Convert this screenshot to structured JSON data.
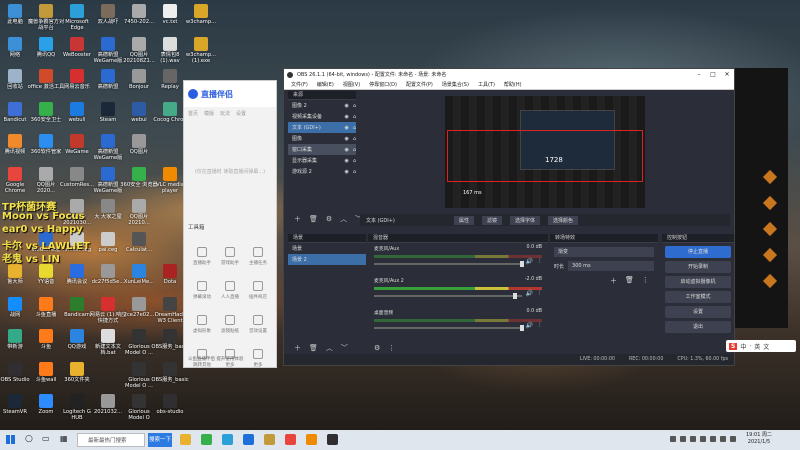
{
  "desktop": {
    "icons": [
      {
        "label": "此电脑",
        "col": 0,
        "row": 0,
        "color": "#3d8fd6"
      },
      {
        "label": "魔兽争霸官方对战平台",
        "col": 1,
        "row": 0,
        "color": "#c29a3a"
      },
      {
        "label": "Microsoft Edge",
        "col": 2,
        "row": 0,
        "color": "#2a9fd8"
      },
      {
        "label": "双人战吓",
        "col": 3,
        "row": 0,
        "color": "#7a6b5a"
      },
      {
        "label": "7450-202...",
        "col": 4,
        "row": 0,
        "color": "#aaa"
      },
      {
        "label": "vc.txt",
        "col": 5,
        "row": 0,
        "color": "#eee"
      },
      {
        "label": "w3champ...",
        "col": 6,
        "row": 0,
        "color": "#d8a72a"
      },
      {
        "label": "网络",
        "col": 0,
        "row": 1,
        "color": "#3d8fd6"
      },
      {
        "label": "腾讯QQ",
        "col": 1,
        "row": 1,
        "color": "#2aa0e8"
      },
      {
        "label": "WeBooster",
        "col": 2,
        "row": 1,
        "color": "#c73535"
      },
      {
        "label": "高德新盟 WeGame版",
        "col": 3,
        "row": 1,
        "color": "#2b6ad0"
      },
      {
        "label": "QQ图片 202108Z1...",
        "col": 4,
        "row": 1,
        "color": "#aaa"
      },
      {
        "label": "表情包8 (1).wav",
        "col": 5,
        "row": 1,
        "color": "#ddd"
      },
      {
        "label": "w3champ... (1).exe",
        "col": 6,
        "row": 1,
        "color": "#d8a72a"
      },
      {
        "label": "回收站",
        "col": 0,
        "row": 2,
        "color": "#9cb3c9"
      },
      {
        "label": "office 激活工具",
        "col": 1,
        "row": 2,
        "color": "#d14b2b"
      },
      {
        "label": "网易云音乐",
        "col": 2,
        "row": 2,
        "color": "#d62f2f"
      },
      {
        "label": "高德新盟",
        "col": 3,
        "row": 2,
        "color": "#2b6ad0"
      },
      {
        "label": "Bonjour",
        "col": 4,
        "row": 2,
        "color": "#999"
      },
      {
        "label": "Replay",
        "col": 5,
        "row": 2,
        "color": "#666"
      },
      {
        "label": "Bandicut",
        "col": 0,
        "row": 3,
        "color": "#3d6fd6"
      },
      {
        "label": "360安全卫士",
        "col": 1,
        "row": 3,
        "color": "#35b04a"
      },
      {
        "label": "webull",
        "col": 2,
        "row": 3,
        "color": "#1c7be0"
      },
      {
        "label": "Steam",
        "col": 3,
        "row": 3,
        "color": "#1b2838"
      },
      {
        "label": "webui",
        "col": 4,
        "row": 3,
        "color": "#2d5ba5"
      },
      {
        "label": "Cocog Chron",
        "col": 5,
        "row": 3,
        "color": "#4a8"
      },
      {
        "label": "腾讯视频",
        "col": 0,
        "row": 4,
        "color": "#f08a2c"
      },
      {
        "label": "360软件管家",
        "col": 1,
        "row": 4,
        "color": "#2c8ef0"
      },
      {
        "label": "WeGame",
        "col": 2,
        "row": 4,
        "color": "#c0392b"
      },
      {
        "label": "高德新盟 WeGame版",
        "col": 3,
        "row": 4,
        "color": "#2b6ad0"
      },
      {
        "label": "QQ图片",
        "col": 4,
        "row": 4,
        "color": "#999"
      },
      {
        "label": "Google Chrome",
        "col": 0,
        "row": 5,
        "color": "#e8453c"
      },
      {
        "label": "QQ图片 2020...",
        "col": 1,
        "row": 5,
        "color": "#aaa"
      },
      {
        "label": "CustomRes...",
        "col": 2,
        "row": 5,
        "color": "#888"
      },
      {
        "label": "高德新盟 WeGame版",
        "col": 3,
        "row": 5,
        "color": "#2b6ad0"
      },
      {
        "label": "360安全 浏览器",
        "col": 4,
        "row": 5,
        "color": "#35b04a"
      },
      {
        "label": "VLC media player",
        "col": 5,
        "row": 5,
        "color": "#f08a00"
      },
      {
        "label": "QQ图片 2021030...",
        "col": 2,
        "row": 6,
        "color": "#aaa"
      },
      {
        "label": "大 大家之屋",
        "col": 3,
        "row": 6,
        "color": "#888"
      },
      {
        "label": "QQ图片 20210...",
        "col": 4,
        "row": 6,
        "color": "#aaa"
      },
      {
        "label": "WeGame版",
        "col": 1,
        "row": 7,
        "color": "#2b6ad0"
      },
      {
        "label": "xmilelf.ceg",
        "col": 2,
        "row": 7,
        "color": "#ccc"
      },
      {
        "label": "pai.ceg",
        "col": 3,
        "row": 7,
        "color": "#ccc"
      },
      {
        "label": "Calculat...",
        "col": 4,
        "row": 7,
        "color": "#555"
      },
      {
        "label": "鲁大师",
        "col": 0,
        "row": 8,
        "color": "#e8b12e"
      },
      {
        "label": "YY语音",
        "col": 1,
        "row": 8,
        "color": "#e8d92e"
      },
      {
        "label": "腾讯会议",
        "col": 2,
        "row": 8,
        "color": "#2a6de0"
      },
      {
        "label": "dc27f5d5e...",
        "col": 3,
        "row": 8,
        "color": "#999"
      },
      {
        "label": "XunLeiMe...",
        "col": 4,
        "row": 8,
        "color": "#2a84e0"
      },
      {
        "label": "Dota",
        "col": 5,
        "row": 8,
        "color": "#a22"
      },
      {
        "label": "战网",
        "col": 0,
        "row": 9,
        "color": "#148eff"
      },
      {
        "label": "斗鱼直播",
        "col": 1,
        "row": 9,
        "color": "#ff7b1a"
      },
      {
        "label": "Bandicam",
        "col": 2,
        "row": 9,
        "color": "#2c7d2c"
      },
      {
        "label": "网易云 (1):响应 快捷方式",
        "col": 3,
        "row": 9,
        "color": "#d62f2f"
      },
      {
        "label": "2ce27e02...",
        "col": 4,
        "row": 9,
        "color": "#999"
      },
      {
        "label": "DreamHack W3 Client",
        "col": 5,
        "row": 9,
        "color": "#444"
      },
      {
        "label": "RUSH ULT",
        "col": 6,
        "row": 9,
        "color": "#a33"
      },
      {
        "label": "带新游",
        "col": 0,
        "row": 10,
        "color": "#3a8"
      },
      {
        "label": "斗鱼",
        "col": 1,
        "row": 10,
        "color": "#ff7b1a"
      },
      {
        "label": "QQ游戏",
        "col": 2,
        "row": 10,
        "color": "#2a84e0"
      },
      {
        "label": "新建文本文档.bat",
        "col": 3,
        "row": 10,
        "color": "#ddd"
      },
      {
        "label": "Glorious Model O ...",
        "col": 4,
        "row": 10,
        "color": "#333"
      },
      {
        "label": "OBS服务_basic",
        "col": 5,
        "row": 10,
        "color": "#333"
      },
      {
        "label": "OBS Studio",
        "col": 0,
        "row": 11,
        "color": "#302e31"
      },
      {
        "label": "斗鱼wall",
        "col": 1,
        "row": 11,
        "color": "#ff7b1a"
      },
      {
        "label": "360文件夹",
        "col": 2,
        "row": 11,
        "color": "#e8b12e"
      },
      {
        "label": "Glorious Model O ...",
        "col": 4,
        "row": 11,
        "color": "#333"
      },
      {
        "label": "OBS服务_basic",
        "col": 5,
        "row": 11,
        "color": "#333"
      },
      {
        "label": "SteamVR",
        "col": 0,
        "row": 12,
        "color": "#1b2838"
      },
      {
        "label": "Zoom",
        "col": 1,
        "row": 12,
        "color": "#2d8cff"
      },
      {
        "label": "Logitech G HUB",
        "col": 2,
        "row": 12,
        "color": "#222"
      },
      {
        "label": "2021032...",
        "col": 3,
        "row": 12,
        "color": "#999"
      },
      {
        "label": "Glorious Model O",
        "col": 4,
        "row": 12,
        "color": "#333"
      },
      {
        "label": "obs-studio",
        "col": 5,
        "row": 12,
        "color": "#302e31"
      }
    ],
    "overlay_lines": [
      "TP杯菌环赛",
      "Moon vs Focus",
      "ear0 vs Happy",
      "卡尔 vs LAWLIET",
      "老鬼 vs LIN"
    ]
  },
  "helper": {
    "brand": "直播伴侣",
    "tabs": [
      "首页",
      "模版",
      "玩法",
      "设置"
    ],
    "placeholder": "(仅在直播时 读取直播间弹幕...)",
    "tools_label": "工具箱",
    "tools": [
      "直播助手",
      "游戏助手",
      "主播任务",
      "弹幕滚动",
      "人人直播",
      "插件商店",
      "虚拟形象",
      "滤镜贴纸",
      "音效设置",
      "跳转其他",
      "更多",
      "更多"
    ],
    "footer": "斗鱼直播伴侣 提升使用体验"
  },
  "obs": {
    "title": "OBS 26.1.1 (64-bit, windows) - 配置文件: 未命名 - 场景: 未命名",
    "menu": [
      "文件(F)",
      "编辑(E)",
      "视图(V)",
      "停靠窗口(D)",
      "配置文件(P)",
      "场景集合(S)",
      "工具(T)",
      "帮助(H)"
    ],
    "sources_title": "来源",
    "sources": [
      {
        "name": "图像 2",
        "state": "normal"
      },
      {
        "name": "视频采集设备",
        "state": "normal"
      },
      {
        "name": "文本 (GDI+)",
        "state": "selected"
      },
      {
        "name": "图像",
        "state": "normal"
      },
      {
        "name": "窗口采集",
        "state": "hover"
      },
      {
        "name": "显示器采集",
        "state": "normal"
      },
      {
        "name": "游戏源 2",
        "state": "normal"
      }
    ],
    "source_toolbar": {
      "current": "文本 (GDI+)",
      "props": "属性",
      "filters": "滤镜",
      "select_font": "选择字体",
      "select_color": "选择颜色"
    },
    "scenes_title": "场景",
    "scenes": [
      "场景",
      "场景 2"
    ],
    "mixer_title": "混音器",
    "mixer": [
      {
        "name": "麦克风/Aux",
        "db": "0.0 dB",
        "active": false,
        "fader": 0.99
      },
      {
        "name": "麦克风/Aux 2",
        "db": "-2.0 dB",
        "active": true,
        "fader": 0.94
      },
      {
        "name": "桌面音频",
        "db": "0.0 dB",
        "active": false,
        "fader": 0.99
      }
    ],
    "transitions_title": "转场特效",
    "transition": "渐变",
    "duration_label": "时长",
    "duration_value": "300 ms",
    "controls_title": "控制按钮",
    "controls": [
      "停止直播",
      "开始录制",
      "启动虚拟摄像机",
      "工作室模式",
      "设置",
      "退出"
    ],
    "status": {
      "live": "LIVE: 00:00:00",
      "rec": "REC: 00:00:00",
      "cpu": "CPU: 1.3%, 60.00 fps"
    },
    "preview_caption": "1728",
    "preview_counter": "167 ms"
  },
  "taskbar": {
    "search": "最新最热门搜索",
    "search_btn": "搜索一下",
    "time": "19:01 周二",
    "date": "2021/1/5"
  },
  "ime": {
    "label": "S",
    "items": [
      "中",
      "·",
      "英",
      "文"
    ]
  }
}
